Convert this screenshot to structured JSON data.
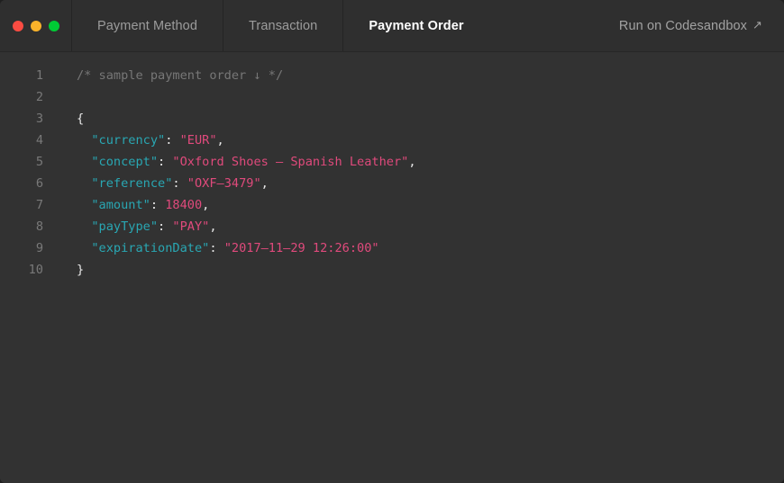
{
  "window": {
    "background_color": "#323232",
    "titlebar_color": "#2f2f2f"
  },
  "titlebar": {
    "traffic_lights": [
      {
        "name": "close",
        "color": "#fb4c42"
      },
      {
        "name": "minimize",
        "color": "#fbb32a"
      },
      {
        "name": "maximize",
        "color": "#00cb35"
      }
    ],
    "tabs": [
      {
        "label": "Payment Method",
        "active": false
      },
      {
        "label": "Transaction",
        "active": false
      },
      {
        "label": "Payment Order",
        "active": true
      }
    ],
    "run_link": {
      "label": "Run on Codesandbox",
      "icon": "external-link-arrow-icon",
      "glyph": "↗"
    }
  },
  "editor": {
    "language": "json",
    "colors": {
      "comment": "#777777",
      "key": "#29a7b3",
      "string": "#e04a7c",
      "number": "#e04a7c",
      "punctuation": "#e8e8e8",
      "gutter": "#797979"
    },
    "line_numbers": [
      "1",
      "2",
      "3",
      "4",
      "5",
      "6",
      "7",
      "8",
      "9",
      "10"
    ],
    "lines": [
      {
        "number": "1",
        "tokens": [
          {
            "type": "comment",
            "text": "/* sample payment order ↓ */"
          }
        ]
      },
      {
        "number": "2",
        "tokens": []
      },
      {
        "number": "3",
        "tokens": [
          {
            "type": "punct",
            "text": "{"
          }
        ]
      },
      {
        "number": "4",
        "tokens": [
          {
            "type": "punct",
            "text": "  "
          },
          {
            "type": "key",
            "text": "\"currency\""
          },
          {
            "type": "punct",
            "text": ": "
          },
          {
            "type": "string",
            "text": "\"EUR\""
          },
          {
            "type": "punct",
            "text": ","
          }
        ]
      },
      {
        "number": "5",
        "tokens": [
          {
            "type": "punct",
            "text": "  "
          },
          {
            "type": "key",
            "text": "\"concept\""
          },
          {
            "type": "punct",
            "text": ": "
          },
          {
            "type": "string",
            "text": "\"Oxford Shoes – Spanish Leather\""
          },
          {
            "type": "punct",
            "text": ","
          }
        ]
      },
      {
        "number": "6",
        "tokens": [
          {
            "type": "punct",
            "text": "  "
          },
          {
            "type": "key",
            "text": "\"reference\""
          },
          {
            "type": "punct",
            "text": ": "
          },
          {
            "type": "string",
            "text": "\"OXF–3479\""
          },
          {
            "type": "punct",
            "text": ","
          }
        ]
      },
      {
        "number": "7",
        "tokens": [
          {
            "type": "punct",
            "text": "  "
          },
          {
            "type": "key",
            "text": "\"amount\""
          },
          {
            "type": "punct",
            "text": ": "
          },
          {
            "type": "number",
            "text": "18400"
          },
          {
            "type": "punct",
            "text": ","
          }
        ]
      },
      {
        "number": "8",
        "tokens": [
          {
            "type": "punct",
            "text": "  "
          },
          {
            "type": "key",
            "text": "\"payType\""
          },
          {
            "type": "punct",
            "text": ": "
          },
          {
            "type": "string",
            "text": "\"PAY\""
          },
          {
            "type": "punct",
            "text": ","
          }
        ]
      },
      {
        "number": "9",
        "tokens": [
          {
            "type": "punct",
            "text": "  "
          },
          {
            "type": "key",
            "text": "\"expirationDate\""
          },
          {
            "type": "punct",
            "text": ": "
          },
          {
            "type": "string",
            "text": "\"2017–11–29 12:26:00\""
          }
        ]
      },
      {
        "number": "10",
        "tokens": [
          {
            "type": "punct",
            "text": "}"
          }
        ]
      }
    ]
  }
}
